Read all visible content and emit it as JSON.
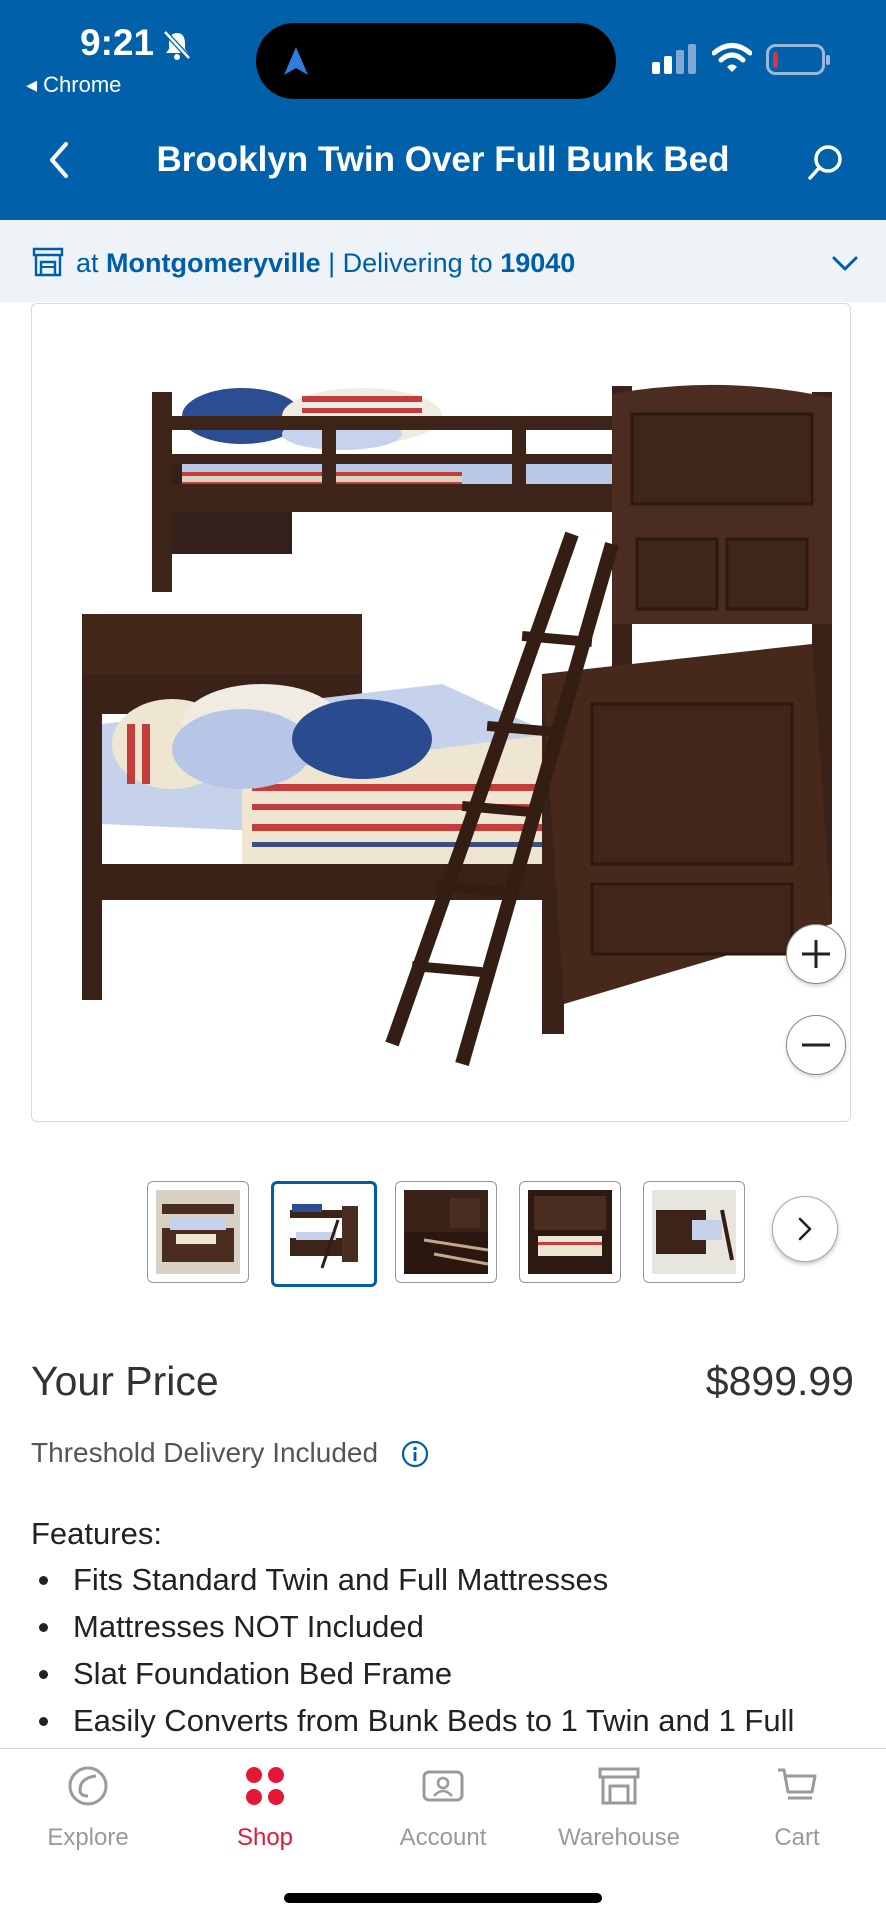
{
  "status_bar": {
    "time": "9:21",
    "back_app": "◂ Chrome"
  },
  "nav": {
    "title": "Brooklyn Twin Over Full Bunk Bed",
    "back_icon": "chevron-left-icon",
    "search_icon": "search-icon"
  },
  "location": {
    "prefix": "at",
    "warehouse": "Montgomeryville",
    "separator": "| Delivering to",
    "zip": "19040"
  },
  "product": {
    "price_label": "Your Price",
    "price": "$899.99",
    "delivery_note": "Threshold Delivery Included",
    "features_title": "Features:",
    "features": [
      "Fits Standard Twin and Full Mattresses",
      "Mattresses NOT Included",
      "Slat Foundation Bed Frame",
      "Easily Converts from Bunk Beds to 1 Twin and 1 Full"
    ]
  },
  "gallery": {
    "thumbnail_count": 5,
    "selected_index": 1
  },
  "tabs": [
    {
      "label": "Explore",
      "icon": "explore-icon"
    },
    {
      "label": "Shop",
      "icon": "shop-icon",
      "active": true
    },
    {
      "label": "Account",
      "icon": "account-icon"
    },
    {
      "label": "Warehouse",
      "icon": "warehouse-icon"
    },
    {
      "label": "Cart",
      "icon": "cart-icon"
    }
  ],
  "colors": {
    "brand_blue": "#0060a9",
    "link_blue": "#005daa",
    "active_red": "#e31837",
    "wood": "#3d2419"
  }
}
